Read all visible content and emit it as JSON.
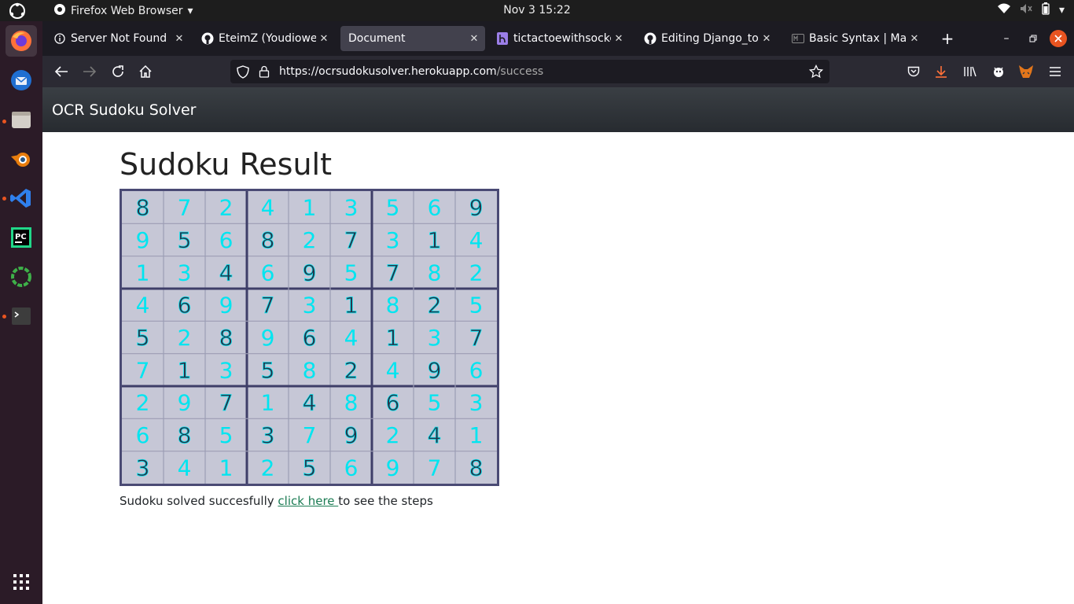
{
  "topbar": {
    "app_name": "Firefox Web Browser",
    "clock": "Nov 3  15:22"
  },
  "dock": {
    "items": [
      {
        "name": "firefox",
        "color": "#ff7139"
      },
      {
        "name": "thunderbird",
        "color": "#3a7bd5"
      },
      {
        "name": "files",
        "color": "#c9c2b8"
      },
      {
        "name": "blender",
        "color": "#e87d0d"
      },
      {
        "name": "vscode",
        "color": "#2f80ed"
      },
      {
        "name": "pycharm",
        "color": "#21d789"
      },
      {
        "name": "anaconda",
        "color": "#3eb049"
      },
      {
        "name": "terminal",
        "color": "#3d3d3d"
      }
    ]
  },
  "tabs": [
    {
      "title": "Server Not Found",
      "icon": "info-icon"
    },
    {
      "title": "EteimZ (Youdiowei E",
      "icon": "github-icon"
    },
    {
      "title": "Document",
      "icon": "none"
    },
    {
      "title": "tictactoewithsocket",
      "icon": "heroku-icon"
    },
    {
      "title": "Editing Django_todo",
      "icon": "github-icon"
    },
    {
      "title": "Basic Syntax | Marko",
      "icon": "markdown-icon"
    }
  ],
  "urlbar": {
    "url_main": "https://ocrsudokusolver.herokuapp.com",
    "url_path": "/success"
  },
  "page": {
    "brand": "OCR Sudoku Solver",
    "heading": "Sudoku Result",
    "result_prefix": "Sudoku solved succesfully ",
    "link_text": "click here ",
    "result_suffix": "to see the steps"
  },
  "sudoku": {
    "grid": [
      [
        8,
        7,
        2,
        4,
        1,
        3,
        5,
        6,
        9
      ],
      [
        9,
        5,
        6,
        8,
        2,
        7,
        3,
        1,
        4
      ],
      [
        1,
        3,
        4,
        6,
        9,
        5,
        7,
        8,
        2
      ],
      [
        4,
        6,
        9,
        7,
        3,
        1,
        8,
        2,
        5
      ],
      [
        5,
        2,
        8,
        9,
        6,
        4,
        1,
        3,
        7
      ],
      [
        7,
        1,
        3,
        5,
        8,
        2,
        4,
        9,
        6
      ],
      [
        2,
        9,
        7,
        1,
        4,
        8,
        6,
        5,
        3
      ],
      [
        6,
        8,
        5,
        3,
        7,
        9,
        2,
        4,
        1
      ],
      [
        3,
        4,
        1,
        2,
        5,
        6,
        9,
        7,
        8
      ]
    ],
    "given": [
      [
        1,
        0,
        0,
        0,
        0,
        0,
        0,
        0,
        1
      ],
      [
        0,
        1,
        0,
        1,
        0,
        1,
        0,
        1,
        0
      ],
      [
        0,
        0,
        1,
        0,
        1,
        0,
        1,
        0,
        0
      ],
      [
        0,
        1,
        0,
        1,
        0,
        1,
        0,
        1,
        0
      ],
      [
        1,
        0,
        1,
        0,
        1,
        0,
        1,
        0,
        1
      ],
      [
        0,
        1,
        0,
        1,
        0,
        1,
        0,
        1,
        0
      ],
      [
        0,
        0,
        1,
        0,
        1,
        0,
        1,
        0,
        0
      ],
      [
        0,
        1,
        0,
        1,
        0,
        1,
        0,
        1,
        0
      ],
      [
        1,
        0,
        0,
        0,
        1,
        0,
        0,
        0,
        1
      ]
    ],
    "given_color": "#2a2f45",
    "solved_color": "#00e5f0"
  }
}
